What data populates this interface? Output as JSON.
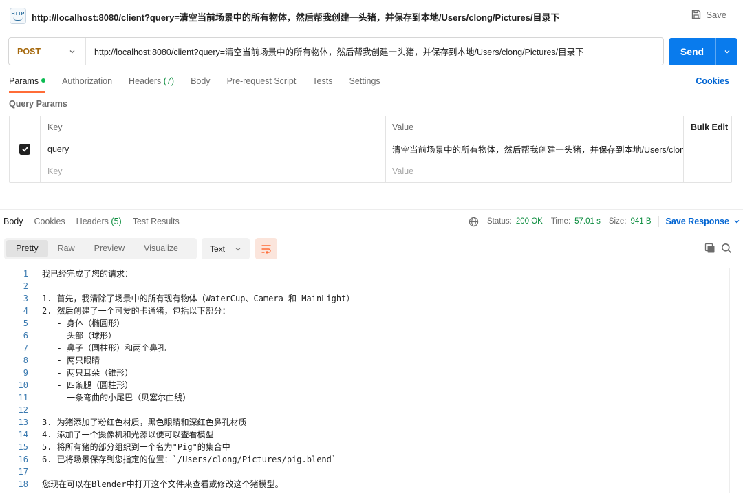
{
  "titlebar": {
    "icon_label": "HTTP",
    "title": "http://localhost:8080/client?query=清空当前场景中的所有物体，然后帮我创建一头猪，并保存到本地/Users/clong/Pictures/目录下",
    "save_label": "Save"
  },
  "request": {
    "method": "POST",
    "url": "http://localhost:8080/client?query=清空当前场景中的所有物体，然后帮我创建一头猪，并保存到本地/Users/clong/Pictures/目录下",
    "send_label": "Send"
  },
  "req_tabs": {
    "params": "Params",
    "authorization": "Authorization",
    "headers": "Headers",
    "headers_count": "(7)",
    "body": "Body",
    "prerequest": "Pre-request Script",
    "tests": "Tests",
    "settings": "Settings",
    "cookies": "Cookies"
  },
  "query_params": {
    "section_label": "Query Params",
    "col_key": "Key",
    "col_value": "Value",
    "bulk_edit": "Bulk Edit",
    "rows": [
      {
        "key": "query",
        "value": "清空当前场景中的所有物体，然后帮我创建一头猪，并保存到本地/Users/clong/Pictu...",
        "checked": true
      }
    ],
    "placeholder_key": "Key",
    "placeholder_value": "Value"
  },
  "res_tabs": {
    "body": "Body",
    "cookies": "Cookies",
    "headers": "Headers",
    "headers_count": "(5)",
    "test_results": "Test Results"
  },
  "status": {
    "status_label": "Status:",
    "status_value": "200 OK",
    "time_label": "Time:",
    "time_value": "57.01 s",
    "size_label": "Size:",
    "size_value": "941 B",
    "save_response": "Save Response"
  },
  "view": {
    "pretty": "Pretty",
    "raw": "Raw",
    "preview": "Preview",
    "visualize": "Visualize",
    "format": "Text"
  },
  "response_lines": [
    "我已经完成了您的请求：",
    "",
    "1. 首先，我清除了场景中的所有现有物体（WaterCup、Camera 和 MainLight）",
    "2. 然后创建了一个可爱的卡通猪，包括以下部分：",
    "   - 身体（椭圆形）",
    "   - 头部（球形）",
    "   - 鼻子（圆柱形）和两个鼻孔",
    "   - 两只眼睛",
    "   - 两只耳朵（锥形）",
    "   - 四条腿（圆柱形）",
    "   - 一条弯曲的小尾巴（贝塞尔曲线）",
    "",
    "3. 为猪添加了粉红色材质，黑色眼睛和深红色鼻孔材质",
    "4. 添加了一个摄像机和光源以便可以查看模型",
    "5. 将所有猪的部分组织到一个名为\"Pig\"的集合中",
    "6. 已将场景保存到您指定的位置：`/Users/clong/Pictures/pig.blend`",
    "",
    "您现在可以在Blender中打开这个文件来查看或修改这个猪模型。"
  ],
  "colors": {
    "accent": "#097bed",
    "method": "#a5680c",
    "tab_underline": "#ff6c37",
    "status_ok": "#0a8c3d",
    "link": "#0265d2"
  }
}
